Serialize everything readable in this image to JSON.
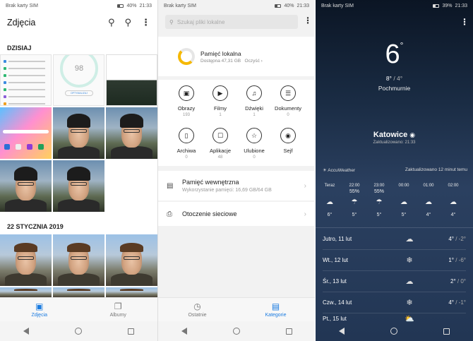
{
  "gallery": {
    "status": {
      "sim": "Brak karty SIM",
      "battery": "40%",
      "time": "21:33"
    },
    "title": "Zdjęcia",
    "actions": {
      "search_icon": "search-icon",
      "map_icon": "map-icon",
      "more_icon": "more-icon"
    },
    "section_today": "DZISIAJ",
    "section_date": "22 STYCZNIA 2019",
    "thumb_gauge_value": "98",
    "thumb_gauge_button": "OPTYMALIZUJ",
    "tabs": [
      {
        "label": "Zdjęcia",
        "icon": "photo-icon"
      },
      {
        "label": "Albumy",
        "icon": "albums-icon"
      }
    ]
  },
  "files": {
    "status": {
      "sim": "Brak karty SIM",
      "battery": "40%",
      "time": "21:33"
    },
    "search_placeholder": "Szukaj pliki lokalne",
    "storage": {
      "title": "Pamięć lokalna",
      "available": "Dostępna 47,31 GB",
      "clean": "Oczyść",
      "used_fraction": 0.29,
      "accent": "#f5b800"
    },
    "categories": [
      {
        "name": "Obrazy",
        "count": "193",
        "icon": "image-icon"
      },
      {
        "name": "Filmy",
        "count": "1",
        "icon": "video-icon"
      },
      {
        "name": "Dźwięki",
        "count": "1",
        "icon": "music-icon"
      },
      {
        "name": "Dokumenty",
        "count": "0",
        "icon": "document-icon"
      },
      {
        "name": "Archiwa",
        "count": "0",
        "icon": "archive-icon"
      },
      {
        "name": "Aplikacje",
        "count": "48",
        "icon": "apps-icon"
      },
      {
        "name": "Ulubione",
        "count": "0",
        "icon": "star-icon"
      },
      {
        "name": "Sejf",
        "count": "",
        "icon": "safe-icon"
      }
    ],
    "internal": {
      "title": "Pamięć wewnętrzna",
      "usage": "Wykorzystanie pamięci: 16,69 GB/64 GB"
    },
    "network": {
      "title": "Otoczenie sieciowe"
    },
    "tabs": [
      {
        "label": "Ostatnie",
        "icon": "clock-icon"
      },
      {
        "label": "Kategorie",
        "icon": "folder-icon"
      }
    ]
  },
  "weather": {
    "status": {
      "sim": "Brak karty SIM",
      "battery": "39%",
      "time": "21:33"
    },
    "temp": "6",
    "deg": "°",
    "high": "8°",
    "low": "/ 4°",
    "condition": "Pochmurnie",
    "city": "Katowice",
    "updated": "Zaktualizowano: 21:33",
    "provider": "AccuWeather",
    "provider_updated": "Zaktualizowano 12 minut temu",
    "hours": [
      {
        "t": "Teraz",
        "p": "",
        "v": "6°",
        "icon": "cloud-icon"
      },
      {
        "t": "22:00",
        "p": "55%",
        "v": "5°",
        "icon": "cloud-rain-icon"
      },
      {
        "t": "23:00",
        "p": "55%",
        "v": "5°",
        "icon": "cloud-rain-icon"
      },
      {
        "t": "00:00",
        "p": "",
        "v": "5°",
        "icon": "cloud-icon"
      },
      {
        "t": "01:00",
        "p": "",
        "v": "4°",
        "icon": "cloud-icon"
      },
      {
        "t": "02:00",
        "p": "",
        "v": "4°",
        "icon": "cloud-icon"
      }
    ],
    "days": [
      {
        "name": "Jutro, 11 lut",
        "hi": "4°",
        "lo": "/ -2°",
        "icon": "cloud-icon"
      },
      {
        "name": "Wt., 12 lut",
        "hi": "1°",
        "lo": "/ -6°",
        "icon": "snow-icon"
      },
      {
        "name": "Śr., 13 lut",
        "hi": "2°",
        "lo": "/ 0°",
        "icon": "cloud-icon"
      },
      {
        "name": "Czw., 14 lut",
        "hi": "4°",
        "lo": "/ -1°",
        "icon": "snow-icon"
      },
      {
        "name": "Pt., 15 lut",
        "hi": "",
        "lo": "",
        "icon": "sun-cloud-icon"
      }
    ]
  }
}
